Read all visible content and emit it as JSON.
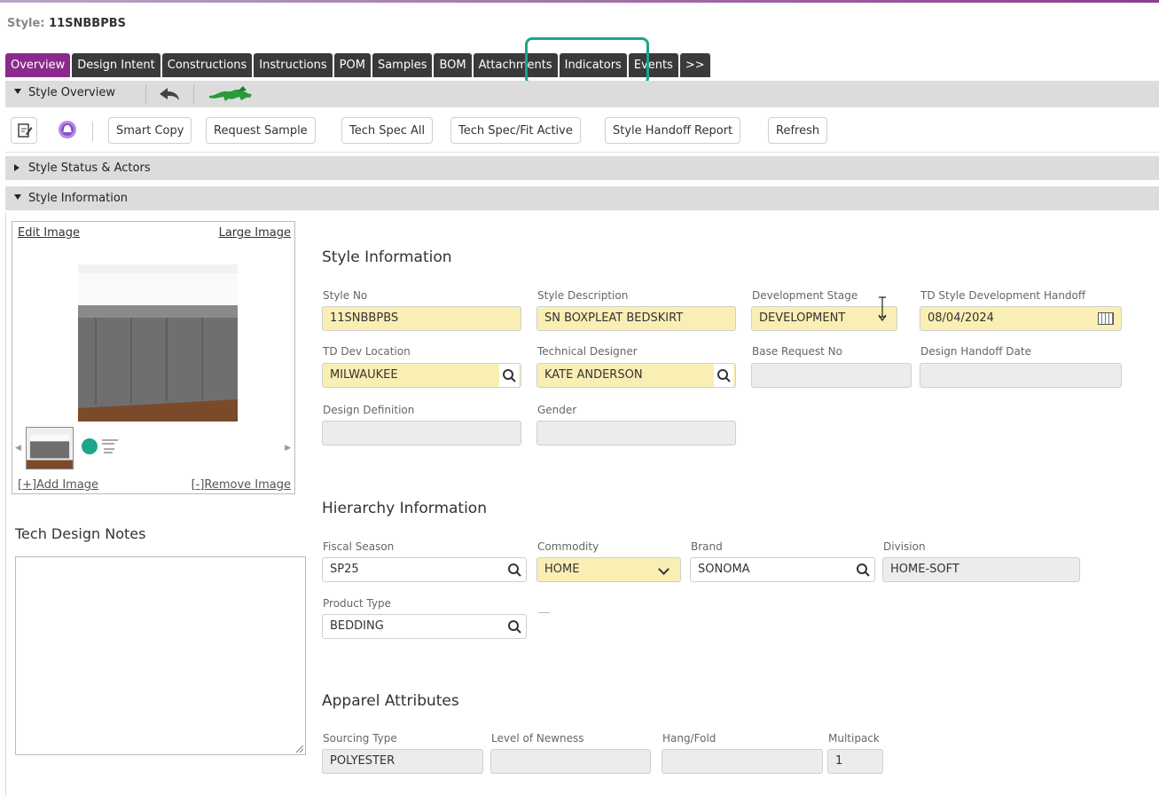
{
  "header": {
    "style_label": "Style:",
    "style_value": "11SNBBPBS"
  },
  "tabs": [
    "Overview",
    "Design Intent",
    "Constructions",
    "Instructions",
    "POM",
    "Samples",
    "BOM",
    "Attachments",
    "Indicators",
    "Events",
    ">>"
  ],
  "active_tab": "Overview",
  "style_overview_bar": {
    "label": "Style Overview"
  },
  "toolbar": {
    "buttons": [
      "Smart Copy",
      "Request Sample",
      "Tech Spec All",
      "Tech Spec/Fit Active",
      "Style Handoff Report",
      "Refresh"
    ]
  },
  "sections": {
    "status_actors": "Style Status & Actors",
    "style_information": "Style Information"
  },
  "image_panel": {
    "edit_image": "Edit Image",
    "large_image": "Large Image",
    "add_image": "[+]Add Image",
    "remove_image": "[-]Remove Image"
  },
  "notes": {
    "title": "Tech Design Notes",
    "value": ""
  },
  "style_info": {
    "heading": "Style Information",
    "style_no": {
      "label": "Style No",
      "value": "11SNBBPBS"
    },
    "style_description": {
      "label": "Style Description",
      "value": "SN BOXPLEAT BEDSKIRT"
    },
    "development_stage": {
      "label": "Development Stage",
      "value": "DEVELOPMENT"
    },
    "td_handoff": {
      "label": "TD Style Development Handoff",
      "value": "08/04/2024"
    },
    "td_dev_location": {
      "label": "TD Dev Location",
      "value": "MILWAUKEE"
    },
    "technical_designer": {
      "label": "Technical Designer",
      "value": "KATE ANDERSON"
    },
    "base_request_no": {
      "label": "Base Request No",
      "value": ""
    },
    "design_handoff_date": {
      "label": "Design Handoff Date",
      "value": ""
    },
    "design_definition": {
      "label": "Design Definition",
      "value": ""
    },
    "gender": {
      "label": "Gender",
      "value": ""
    }
  },
  "hierarchy": {
    "heading": "Hierarchy Information",
    "fiscal_season": {
      "label": "Fiscal Season",
      "value": "SP25"
    },
    "commodity": {
      "label": "Commodity",
      "value": "HOME"
    },
    "brand": {
      "label": "Brand",
      "value": "SONOMA"
    },
    "division": {
      "label": "Division",
      "value": "HOME-SOFT"
    },
    "product_type": {
      "label": "Product Type",
      "value": "BEDDING"
    }
  },
  "apparel": {
    "heading": "Apparel Attributes",
    "sourcing_type": {
      "label": "Sourcing Type",
      "value": "POLYESTER"
    },
    "level_of_newness": {
      "label": "Level of Newness",
      "value": ""
    },
    "hang_fold": {
      "label": "Hang/Fold",
      "value": ""
    },
    "multipack": {
      "label": "Multipack",
      "value": "1"
    }
  },
  "colors": {
    "active_tab": "#8b2a8b",
    "tab": "#3a3a3a",
    "required_field": "#f9efb4",
    "highlight": "#1fa38b"
  }
}
